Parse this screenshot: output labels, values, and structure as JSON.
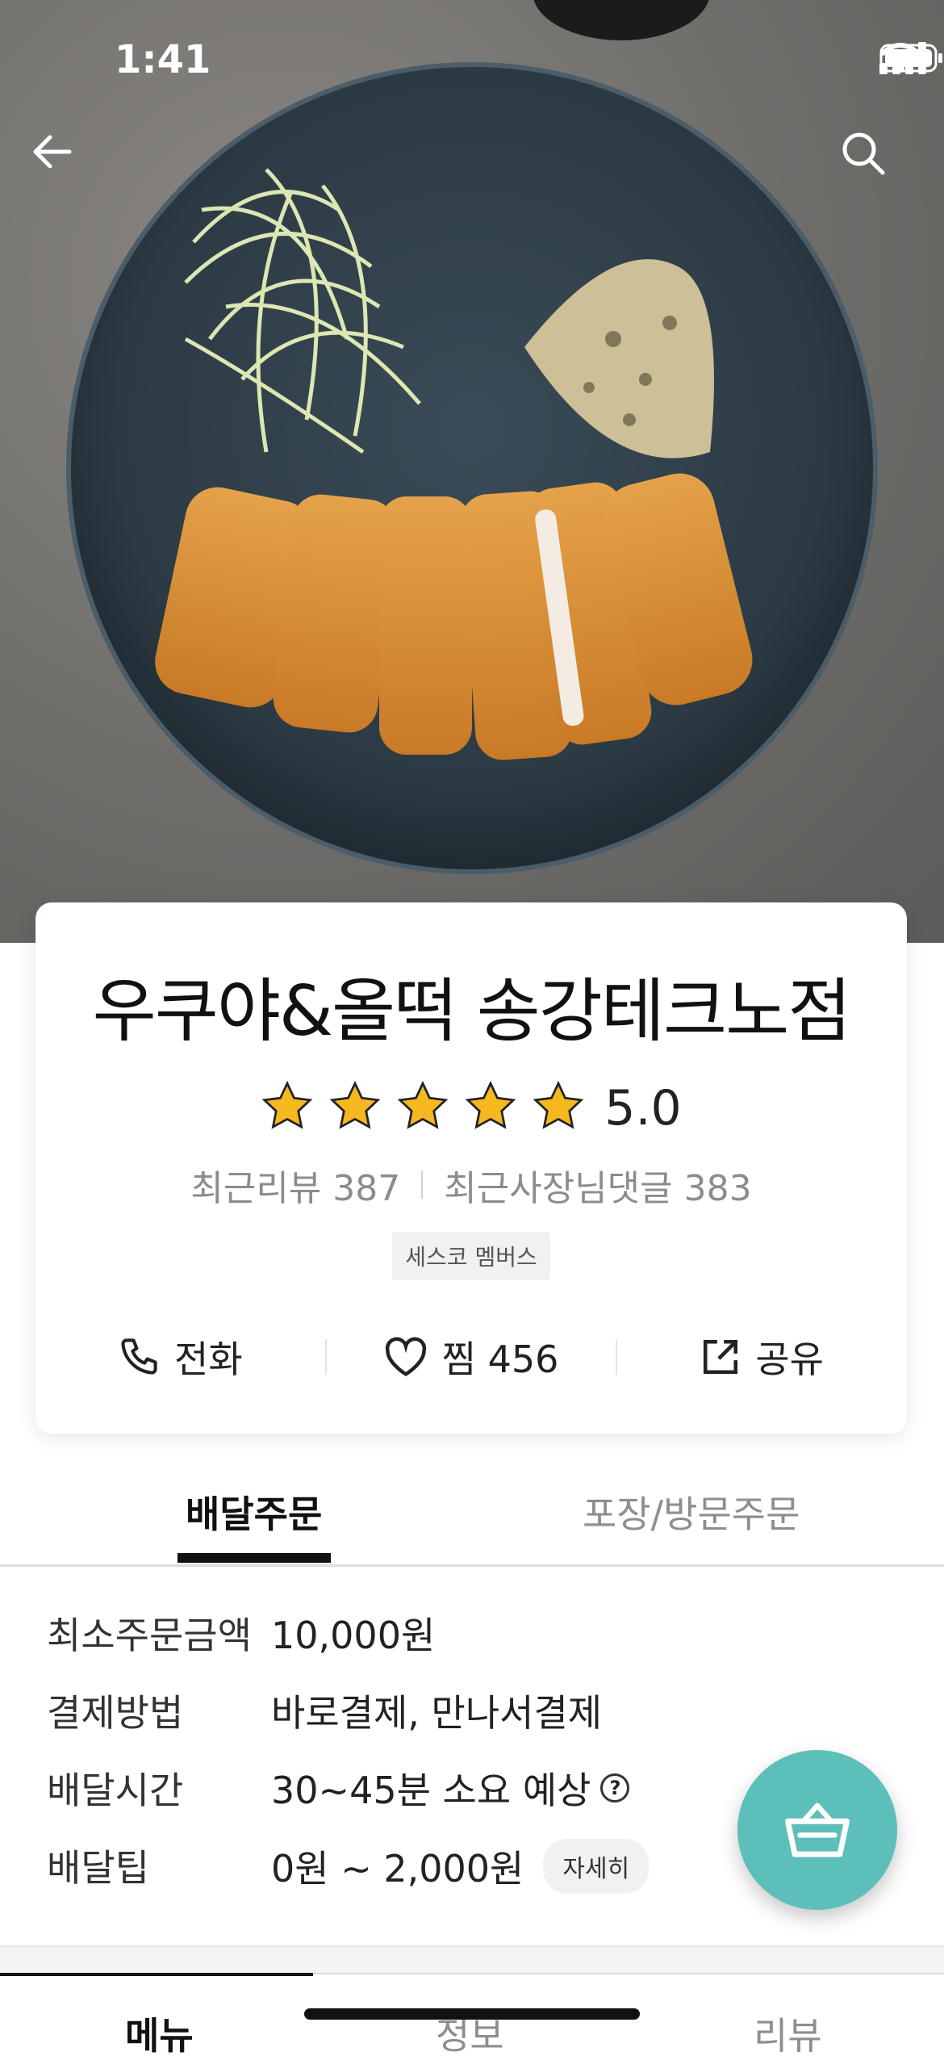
{
  "status_bar": {
    "time": "1:41"
  },
  "store": {
    "name": "우쿠야&올떡  송강테크노점",
    "rating": 5,
    "rating_text": "5.0",
    "recent_reviews_label": "최근리뷰 387",
    "recent_owner_replies_label": "최근사장님댓글 383",
    "badge": "세스코 멤버스"
  },
  "actions": {
    "call_label": "전화",
    "like_label": "찜 456",
    "share_label": "공유"
  },
  "order_tabs": {
    "delivery": "배달주문",
    "pickup": "포장/방문주문"
  },
  "delivery_info": [
    {
      "label": "최소주문금액",
      "value": "10,000원"
    },
    {
      "label": "결제방법",
      "value": "바로결제, 만나서결제"
    },
    {
      "label": "배달시간",
      "value": "30~45분 소요 예상"
    },
    {
      "label": "배달팁",
      "value": "0원 ~ 2,000원",
      "chip": "자세히"
    }
  ],
  "menu_tabs": [
    "메뉴",
    "정보",
    "리뷰"
  ],
  "colors": {
    "accent": "#5dbfba",
    "star": "#f5b81f"
  }
}
